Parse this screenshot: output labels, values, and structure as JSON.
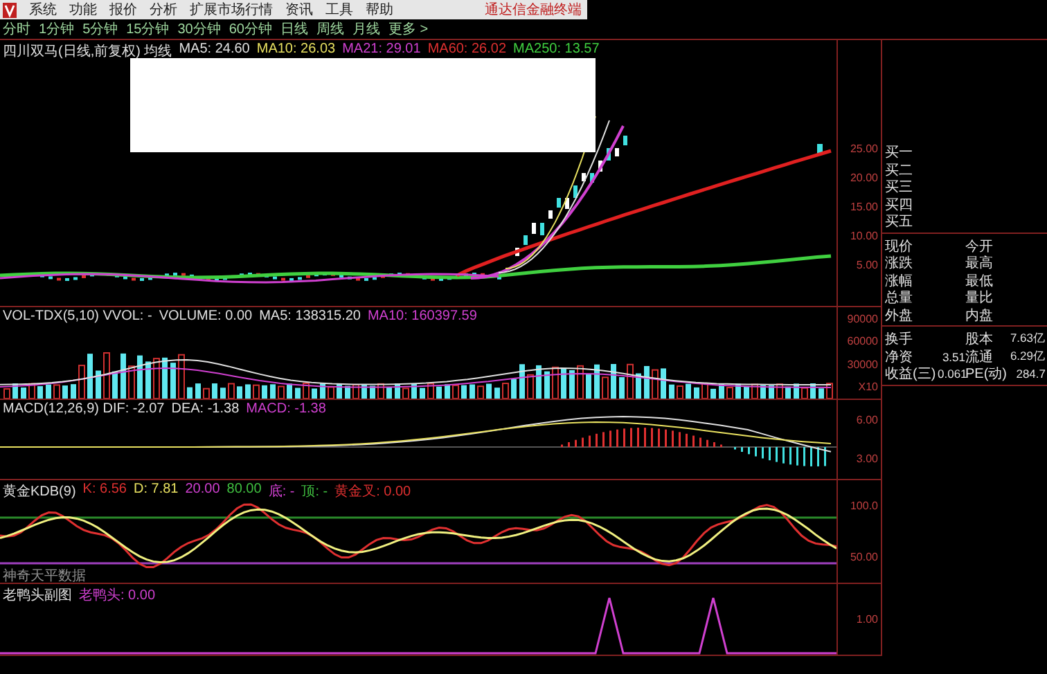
{
  "menu_bar": {
    "items": [
      "系统",
      "功能",
      "报价",
      "分析",
      "扩展市场行情",
      "资讯",
      "工具",
      "帮助"
    ],
    "terminal_label": "通达信金融终端"
  },
  "period_bar": {
    "items": [
      "分时",
      "1分钟",
      "5分钟",
      "15分钟",
      "30分钟",
      "60分钟",
      "日线",
      "周线",
      "月线",
      "更多 >"
    ]
  },
  "price_pane": {
    "legend": [
      {
        "text": "四川双马(日线,前复权) 均线",
        "color": "#e0e0e0"
      },
      {
        "text": "MA5: 24.60",
        "color": "#e0e0e0"
      },
      {
        "text": "MA10: 26.03",
        "color": "#e8e060"
      },
      {
        "text": "MA21: 29.01",
        "color": "#d040d0"
      },
      {
        "text": "MA60: 26.02",
        "color": "#e03030"
      },
      {
        "text": "MA250: 13.57",
        "color": "#40d040"
      }
    ],
    "axis_labels": [
      "25.00",
      "20.00",
      "15.00",
      "10.00",
      "5.00"
    ]
  },
  "volume_pane": {
    "legend": [
      {
        "text": "VOL-TDX(5,10) VVOL: -",
        "color": "#e0e0e0"
      },
      {
        "text": "VOLUME: 0.00",
        "color": "#e0e0e0"
      },
      {
        "text": "MA5: 138315.20",
        "color": "#e0e0e0"
      },
      {
        "text": "MA10: 160397.59",
        "color": "#d040d0"
      }
    ],
    "axis_labels": [
      "90000",
      "60000",
      "30000",
      "X10"
    ]
  },
  "macd_pane": {
    "legend": [
      {
        "text": "MACD(12,26,9) DIF: -2.07",
        "color": "#e0e0e0"
      },
      {
        "text": "DEA: -1.38",
        "color": "#e0e0e0"
      },
      {
        "text": "MACD: -1.38",
        "color": "#d040d0"
      }
    ],
    "axis_labels": [
      "6.00",
      "3.00"
    ]
  },
  "kdj_pane": {
    "legend": [
      {
        "text": "黄金KDB(9)",
        "color": "#e0e0e0"
      },
      {
        "text": "K: 6.56",
        "color": "#e03030"
      },
      {
        "text": "D: 7.81",
        "color": "#e8e060"
      },
      {
        "text": "20.00",
        "color": "#d040d0"
      },
      {
        "text": "80.00",
        "color": "#40c040"
      },
      {
        "text": "底: -",
        "color": "#d040d0"
      },
      {
        "text": "顶: -",
        "color": "#40c040"
      },
      {
        "text": "黄金叉: 0.00",
        "color": "#e03030"
      }
    ],
    "note": "神奇天平数据",
    "axis_labels": [
      "100.0",
      "50.00"
    ]
  },
  "bottom_pane": {
    "legend": [
      {
        "text": "老鸭头副图",
        "color": "#e0e0e0"
      },
      {
        "text": "老鸭头: 0.00",
        "color": "#d040d0"
      }
    ],
    "axis_labels": [
      "1.00"
    ]
  },
  "quote_panel": {
    "bids": [
      "买一",
      "买二",
      "买三",
      "买四",
      "买五"
    ],
    "quotes": [
      {
        "label": "现价",
        "label_2": "今开"
      },
      {
        "label": "涨跌",
        "label_2": "最高"
      },
      {
        "label": "涨幅",
        "label_2": "最低"
      },
      {
        "label": "总量",
        "label_2": "量比"
      },
      {
        "label": "外盘",
        "label_2": "内盘"
      }
    ],
    "stats": [
      {
        "label": "换手",
        "label_2": "股本",
        "value_2": "7.63亿"
      },
      {
        "label": "净资",
        "value": "3.51",
        "label_2": "流通",
        "value_2": "6.29亿"
      },
      {
        "label": "收益(三)",
        "value": "0.061",
        "label_2": "PE(动)",
        "value_2": "284.7"
      }
    ]
  }
}
